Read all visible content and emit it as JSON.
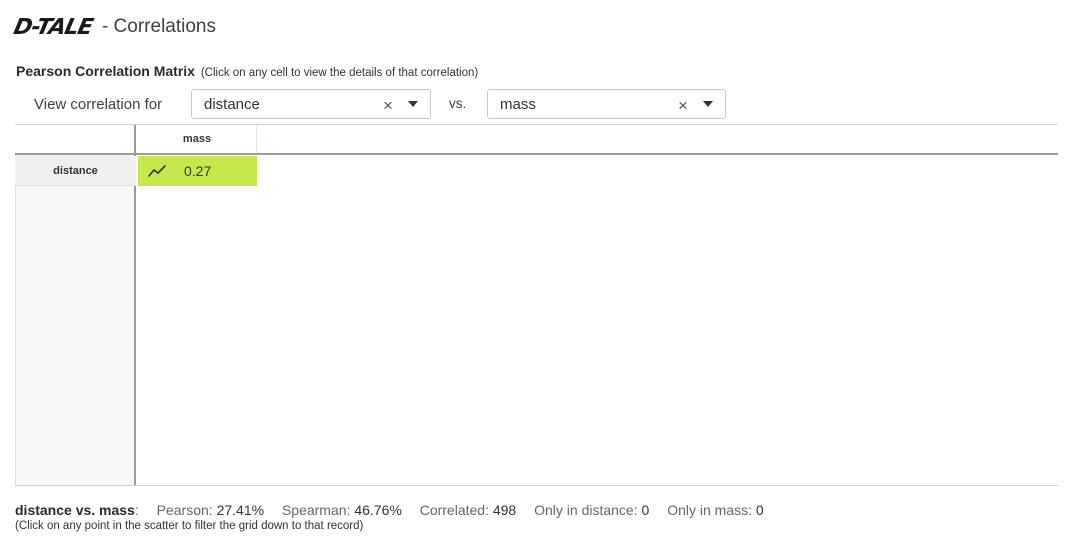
{
  "header": {
    "logo": "D-TALE",
    "title": "- Correlations"
  },
  "matrix": {
    "title": "Pearson Correlation Matrix",
    "hint": "(Click on any cell to view the details of that correlation)"
  },
  "controls": {
    "view_label": "View correlation for",
    "select1_value": "distance",
    "vs_label": "vs.",
    "select2_value": "mass",
    "clear_glyph": "×"
  },
  "grid": {
    "column_header": "mass",
    "row_header": "distance",
    "cell_value": "0.27",
    "cell_color": "#c5e84d"
  },
  "footer": {
    "pair": "distance vs. mass",
    "colon": ":",
    "pearson_label": "Pearson:",
    "pearson_value": "27.41%",
    "spearman_label": "Spearman:",
    "spearman_value": "46.76%",
    "correlated_label": "Correlated:",
    "correlated_value": "498",
    "only1_label": "Only in distance:",
    "only1_value": "0",
    "only2_label": "Only in mass:",
    "only2_value": "0",
    "sub": "(Click on any point in the scatter to filter the grid down to that record)"
  }
}
